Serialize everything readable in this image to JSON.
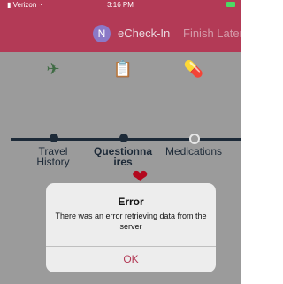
{
  "statusbar": {
    "carrier": "Verizon",
    "time": "3:16 PM"
  },
  "nav": {
    "avatar_letter": "N",
    "title": "eCheck-In",
    "right": "Finish Later"
  },
  "steps": [
    {
      "label_line1": "Travel",
      "label_line2": "History",
      "state": "done"
    },
    {
      "label_line1": "Questionna",
      "label_line2": "ires",
      "state": "current"
    },
    {
      "label_line1": "Medications",
      "label_line2": "",
      "state": "pending"
    }
  ],
  "dialog": {
    "title": "Error",
    "message": "There was an error retrieving data from the server",
    "button": "OK"
  },
  "colors": {
    "accent": "#b33a56",
    "overlay": "#9b9b9b",
    "track": "#1d2a38"
  }
}
